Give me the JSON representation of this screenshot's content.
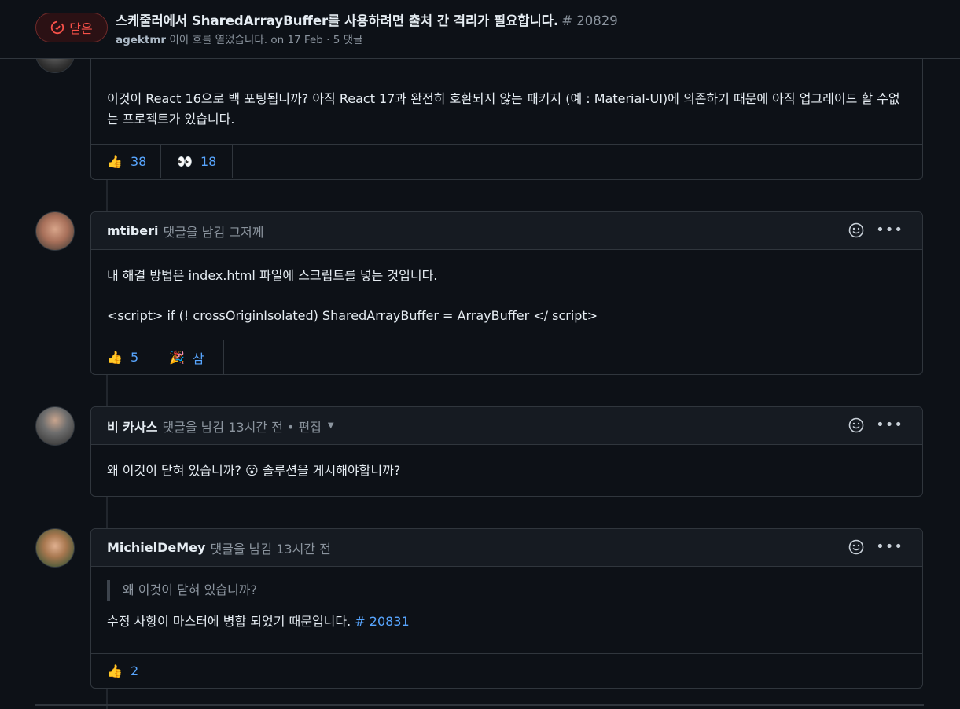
{
  "header": {
    "state_label": "닫은",
    "title": "스케줄러에서 SharedArrayBuffer를 사용하려면 출처 간 격리가 필요합니다.",
    "number": "# 20829",
    "author": "agektmr",
    "meta_text": "이이 호를 열었습니다. on 17 Feb · 5 댓글"
  },
  "comments": [
    {
      "author": "",
      "body": "이것이 React 16으로 백 포팅됩니까? 아직 React 17과 완전히 호환되지 않는 패키지 (예 : Material-UI)에 의존하기 때문에 아직 업그레이드 할 수없는 프로젝트가 있습니다.",
      "reactions": [
        {
          "emoji": "👍",
          "count": "38"
        },
        {
          "emoji": "👀",
          "count": "18"
        }
      ]
    },
    {
      "author": "mtiberi",
      "meta": "댓글을 남김 그저께",
      "body_line1": "내 해결 방법은 index.html 파일에 스크립트를 넣는 것입니다.",
      "body_line2": "<script> if (! crossOriginIsolated) SharedArrayBuffer = ArrayBuffer </ script>",
      "reactions": [
        {
          "emoji": "👍",
          "count": "5"
        },
        {
          "emoji": "🎉",
          "count": "삼"
        }
      ]
    },
    {
      "author": "비 카사스",
      "meta": "댓글을 남김 13시간 전 • 편집",
      "body_before": "왜 이것이 닫혀 있습니까?",
      "emoji": "😮",
      "body_after": "솔루션을 게시해야합니까?"
    },
    {
      "author": "MichielDeMey",
      "meta": "댓글을 남김 13시간 전",
      "quote": "왜 이것이 닫혀 있습니까?",
      "body": "수정 사항이 마스터에 병합 되었기 때문입니다.",
      "link": "# 20831",
      "reactions": [
        {
          "emoji": "👍",
          "count": "2"
        }
      ]
    }
  ],
  "colors": {
    "background": "#0d1117",
    "closed_red": "#f85149",
    "link_blue": "#58a6ff"
  }
}
